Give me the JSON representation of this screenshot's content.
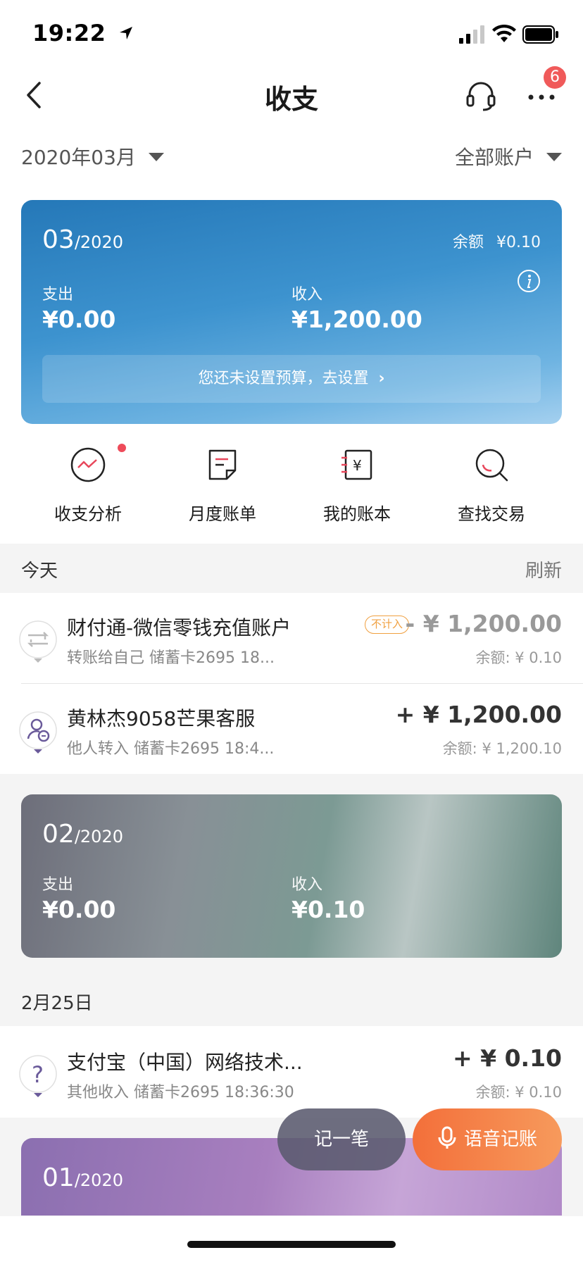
{
  "status_bar": {
    "time": "19:22"
  },
  "nav": {
    "title": "收支",
    "notification_count": "6"
  },
  "filter": {
    "month": "2020年03月",
    "account": "全部账户"
  },
  "current_card": {
    "month": "03",
    "year": "/2020",
    "balance_label": "余额",
    "balance_value": "¥0.10",
    "expense_label": "支出",
    "expense_value": "¥0.00",
    "income_label": "收入",
    "income_value": "¥1,200.00",
    "budget_prompt": "您还未设置预算，去设置"
  },
  "actions": [
    {
      "label": "收支分析",
      "icon": "trend-chart-icon",
      "has_dot": true
    },
    {
      "label": "月度账单",
      "icon": "monthly-bill-icon"
    },
    {
      "label": "我的账本",
      "icon": "ledger-icon"
    },
    {
      "label": "查找交易",
      "icon": "search-icon"
    }
  ],
  "today_section": {
    "title": "今天",
    "refresh_label": "刷新"
  },
  "today_transactions": [
    {
      "title": "财付通-微信零钱充值账户",
      "tag": "不计入",
      "subtitle": "转账给自己   储蓄卡2695 18...",
      "amount": "- ¥  1,200.00",
      "balance": "余额: ¥ 0.10",
      "icon": "transfer-icon"
    },
    {
      "title": "黄林杰9058芒果客服",
      "subtitle": "他人转入   储蓄卡2695 18:4...",
      "amount": "+ ¥  1,200.00",
      "balance": "余额: ¥ 1,200.10",
      "icon": "person-transfer-in-icon"
    }
  ],
  "feb_card": {
    "month": "02",
    "year": "/2020",
    "expense_label": "支出",
    "expense_value": "¥0.00",
    "income_label": "收入",
    "income_value": "¥0.10"
  },
  "feb_section": {
    "title": "2月25日"
  },
  "feb_transactions": [
    {
      "title": "支付宝（中国）网络技术...",
      "subtitle": "其他收入   储蓄卡2695 18:36:30",
      "amount": "+ ¥  0.10",
      "balance": "余额: ¥ 0.10",
      "icon": "question-icon"
    }
  ],
  "jan_card": {
    "month": "01",
    "year": "/2020"
  },
  "fab": {
    "record_label": "记一笔",
    "voice_label": "语音记账"
  },
  "colors": {
    "accent_orange": "#f36f3a",
    "badge_red": "#f05a5a",
    "card_blue": "#2578b8"
  }
}
